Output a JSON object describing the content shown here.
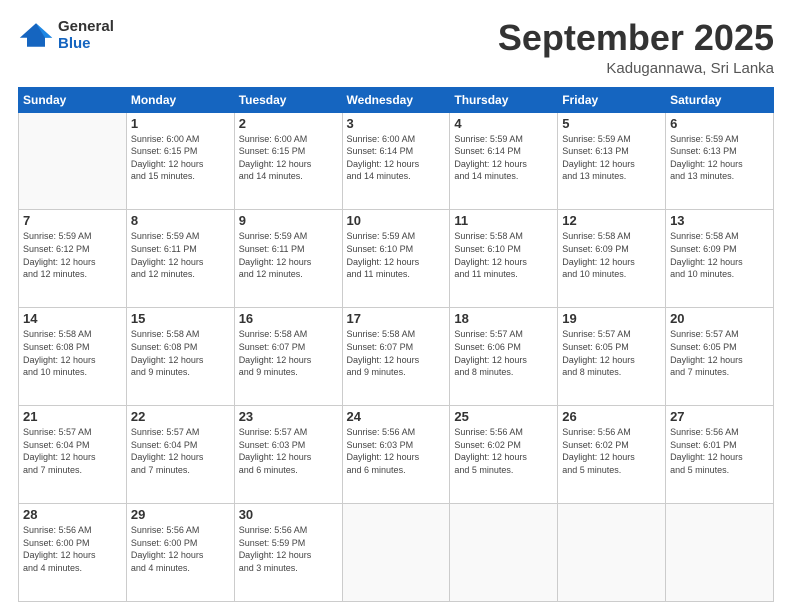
{
  "header": {
    "logo_line1": "General",
    "logo_line2": "Blue",
    "month": "September 2025",
    "location": "Kadugannawa, Sri Lanka"
  },
  "weekdays": [
    "Sunday",
    "Monday",
    "Tuesday",
    "Wednesday",
    "Thursday",
    "Friday",
    "Saturday"
  ],
  "weeks": [
    [
      {
        "day": "",
        "info": ""
      },
      {
        "day": "1",
        "info": "Sunrise: 6:00 AM\nSunset: 6:15 PM\nDaylight: 12 hours\nand 15 minutes."
      },
      {
        "day": "2",
        "info": "Sunrise: 6:00 AM\nSunset: 6:15 PM\nDaylight: 12 hours\nand 14 minutes."
      },
      {
        "day": "3",
        "info": "Sunrise: 6:00 AM\nSunset: 6:14 PM\nDaylight: 12 hours\nand 14 minutes."
      },
      {
        "day": "4",
        "info": "Sunrise: 5:59 AM\nSunset: 6:14 PM\nDaylight: 12 hours\nand 14 minutes."
      },
      {
        "day": "5",
        "info": "Sunrise: 5:59 AM\nSunset: 6:13 PM\nDaylight: 12 hours\nand 13 minutes."
      },
      {
        "day": "6",
        "info": "Sunrise: 5:59 AM\nSunset: 6:13 PM\nDaylight: 12 hours\nand 13 minutes."
      }
    ],
    [
      {
        "day": "7",
        "info": "Sunrise: 5:59 AM\nSunset: 6:12 PM\nDaylight: 12 hours\nand 12 minutes."
      },
      {
        "day": "8",
        "info": "Sunrise: 5:59 AM\nSunset: 6:11 PM\nDaylight: 12 hours\nand 12 minutes."
      },
      {
        "day": "9",
        "info": "Sunrise: 5:59 AM\nSunset: 6:11 PM\nDaylight: 12 hours\nand 12 minutes."
      },
      {
        "day": "10",
        "info": "Sunrise: 5:59 AM\nSunset: 6:10 PM\nDaylight: 12 hours\nand 11 minutes."
      },
      {
        "day": "11",
        "info": "Sunrise: 5:58 AM\nSunset: 6:10 PM\nDaylight: 12 hours\nand 11 minutes."
      },
      {
        "day": "12",
        "info": "Sunrise: 5:58 AM\nSunset: 6:09 PM\nDaylight: 12 hours\nand 10 minutes."
      },
      {
        "day": "13",
        "info": "Sunrise: 5:58 AM\nSunset: 6:09 PM\nDaylight: 12 hours\nand 10 minutes."
      }
    ],
    [
      {
        "day": "14",
        "info": "Sunrise: 5:58 AM\nSunset: 6:08 PM\nDaylight: 12 hours\nand 10 minutes."
      },
      {
        "day": "15",
        "info": "Sunrise: 5:58 AM\nSunset: 6:08 PM\nDaylight: 12 hours\nand 9 minutes."
      },
      {
        "day": "16",
        "info": "Sunrise: 5:58 AM\nSunset: 6:07 PM\nDaylight: 12 hours\nand 9 minutes."
      },
      {
        "day": "17",
        "info": "Sunrise: 5:58 AM\nSunset: 6:07 PM\nDaylight: 12 hours\nand 9 minutes."
      },
      {
        "day": "18",
        "info": "Sunrise: 5:57 AM\nSunset: 6:06 PM\nDaylight: 12 hours\nand 8 minutes."
      },
      {
        "day": "19",
        "info": "Sunrise: 5:57 AM\nSunset: 6:05 PM\nDaylight: 12 hours\nand 8 minutes."
      },
      {
        "day": "20",
        "info": "Sunrise: 5:57 AM\nSunset: 6:05 PM\nDaylight: 12 hours\nand 7 minutes."
      }
    ],
    [
      {
        "day": "21",
        "info": "Sunrise: 5:57 AM\nSunset: 6:04 PM\nDaylight: 12 hours\nand 7 minutes."
      },
      {
        "day": "22",
        "info": "Sunrise: 5:57 AM\nSunset: 6:04 PM\nDaylight: 12 hours\nand 7 minutes."
      },
      {
        "day": "23",
        "info": "Sunrise: 5:57 AM\nSunset: 6:03 PM\nDaylight: 12 hours\nand 6 minutes."
      },
      {
        "day": "24",
        "info": "Sunrise: 5:56 AM\nSunset: 6:03 PM\nDaylight: 12 hours\nand 6 minutes."
      },
      {
        "day": "25",
        "info": "Sunrise: 5:56 AM\nSunset: 6:02 PM\nDaylight: 12 hours\nand 5 minutes."
      },
      {
        "day": "26",
        "info": "Sunrise: 5:56 AM\nSunset: 6:02 PM\nDaylight: 12 hours\nand 5 minutes."
      },
      {
        "day": "27",
        "info": "Sunrise: 5:56 AM\nSunset: 6:01 PM\nDaylight: 12 hours\nand 5 minutes."
      }
    ],
    [
      {
        "day": "28",
        "info": "Sunrise: 5:56 AM\nSunset: 6:00 PM\nDaylight: 12 hours\nand 4 minutes."
      },
      {
        "day": "29",
        "info": "Sunrise: 5:56 AM\nSunset: 6:00 PM\nDaylight: 12 hours\nand 4 minutes."
      },
      {
        "day": "30",
        "info": "Sunrise: 5:56 AM\nSunset: 5:59 PM\nDaylight: 12 hours\nand 3 minutes."
      },
      {
        "day": "",
        "info": ""
      },
      {
        "day": "",
        "info": ""
      },
      {
        "day": "",
        "info": ""
      },
      {
        "day": "",
        "info": ""
      }
    ]
  ]
}
